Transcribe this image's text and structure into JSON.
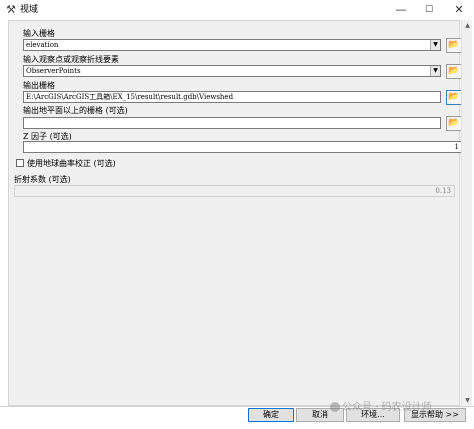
{
  "window": {
    "title": "视域",
    "title_icon": "hammer-icon",
    "minimize_glyph": "—",
    "maximize_glyph": "☐",
    "close_glyph": "✕"
  },
  "form": {
    "input_raster_label": "输入栅格",
    "input_raster_value": "elevation",
    "observer_label": "输入观察点或观察折线要素",
    "observer_value": "ObserverPoints",
    "output_raster_label": "输出栅格",
    "output_raster_value": "E:\\ArcGIS\\ArcGIS工具箱\\EX_15\\result\\result.gdb\\Viewshed",
    "above_ground_label": "输出地平面以上的栅格 (可选)",
    "above_ground_value": "",
    "z_factor_label": "Z 因子 (可选)",
    "z_factor_value": "1",
    "curvature_label": "使用地球曲率校正 (可选)",
    "curvature_checked": false,
    "refraction_label": "折射系数 (可选)",
    "refraction_value": "0.13"
  },
  "buttons": {
    "ok": "确定",
    "cancel": "取消",
    "environments": "环境...",
    "show_help": "显示帮助 >>"
  },
  "icons": {
    "dropdown": "▼",
    "folder": "folder-open-icon",
    "scroll_up": "▲",
    "scroll_down": "▼"
  },
  "watermark": "公众号 · 码农设计师"
}
